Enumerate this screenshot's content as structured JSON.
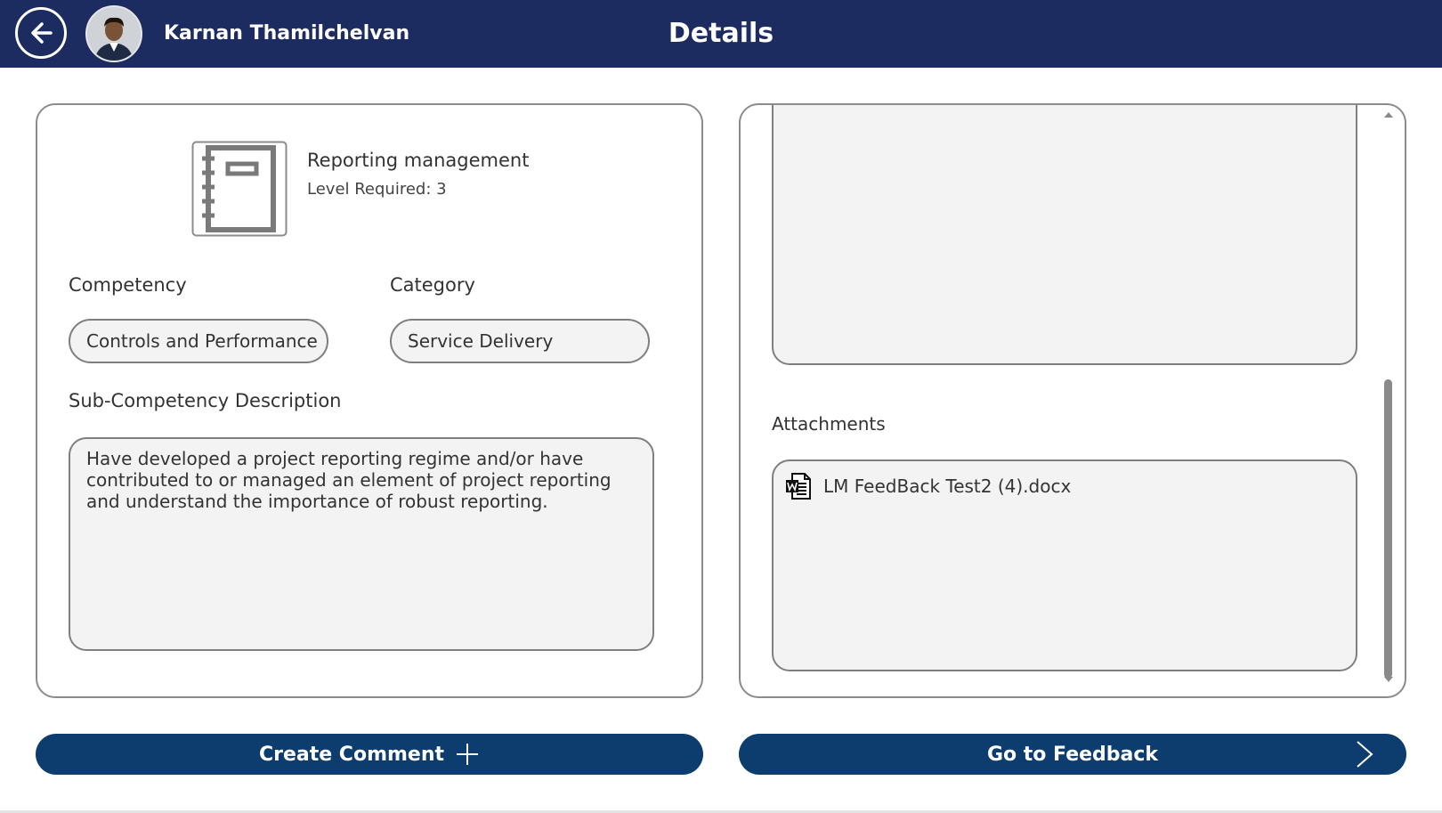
{
  "header": {
    "user_name": "Karnan Thamilchelvan",
    "title": "Details",
    "background_color": "#1c2b60"
  },
  "competency_card": {
    "title": "Reporting management",
    "level_required": "Level Required: 3",
    "competency_label": "Competency",
    "competency_value": "Controls and Performance",
    "category_label": "Category",
    "category_value": "Service Delivery",
    "description_label": "Sub-Competency Description",
    "description_text": "Have developed a project reporting regime and/or have contributed to or managed an element of project reporting and understand the importance of robust reporting."
  },
  "details_panel": {
    "attachments_label": "Attachments",
    "attachments": [
      {
        "file_name": "LM FeedBack Test2 (4).docx",
        "icon": "word-document-icon"
      }
    ]
  },
  "actions": {
    "create_comment_label": "Create Comment",
    "go_to_feedback_label": "Go to Feedback",
    "button_color": "#0c3d6e"
  }
}
